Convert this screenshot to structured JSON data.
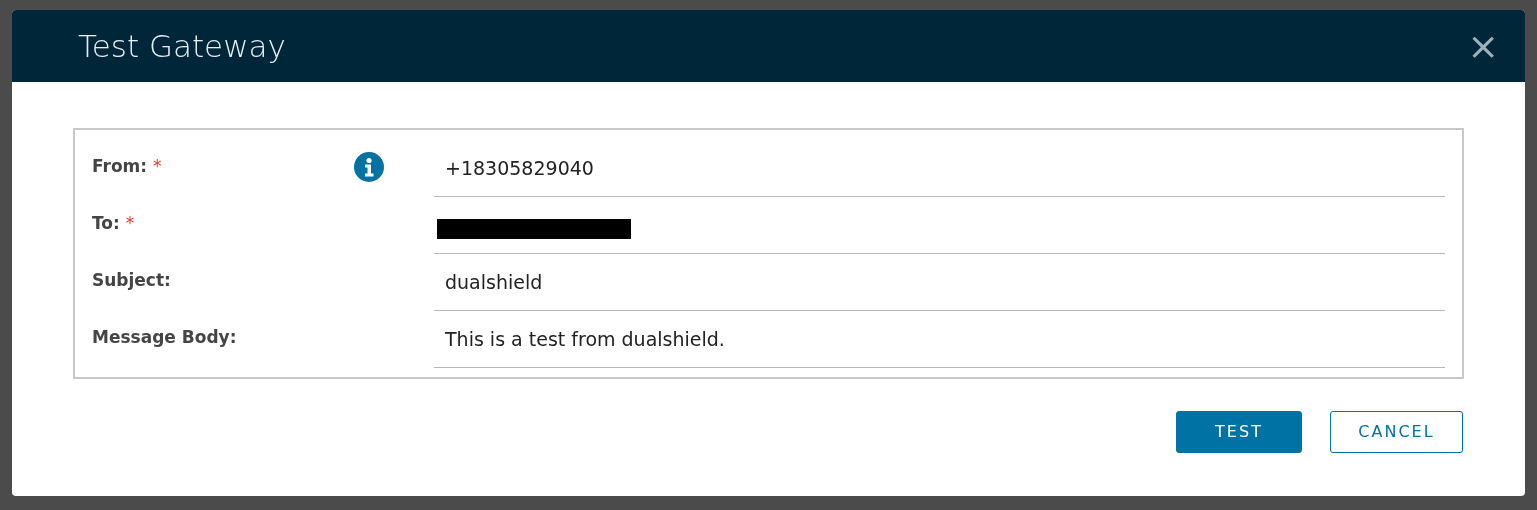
{
  "dialog": {
    "title": "Test Gateway",
    "close": "×"
  },
  "fields": [
    {
      "label": "From:",
      "required": true,
      "info": true,
      "value": "+18305829040",
      "redacted": false
    },
    {
      "label": "To:",
      "required": true,
      "info": false,
      "redacted": true
    },
    {
      "label": "Subject:",
      "required": false,
      "info": false,
      "value": "dualshield",
      "redacted": false
    },
    {
      "label": "Message Body:",
      "required": false,
      "info": false,
      "value": "This is a test from dualshield.",
      "redacted": false
    }
  ],
  "required_mark": "*",
  "buttons": [
    {
      "label": "TEST",
      "kind": "primary"
    },
    {
      "label": "CANCEL",
      "kind": "outline"
    }
  ]
}
